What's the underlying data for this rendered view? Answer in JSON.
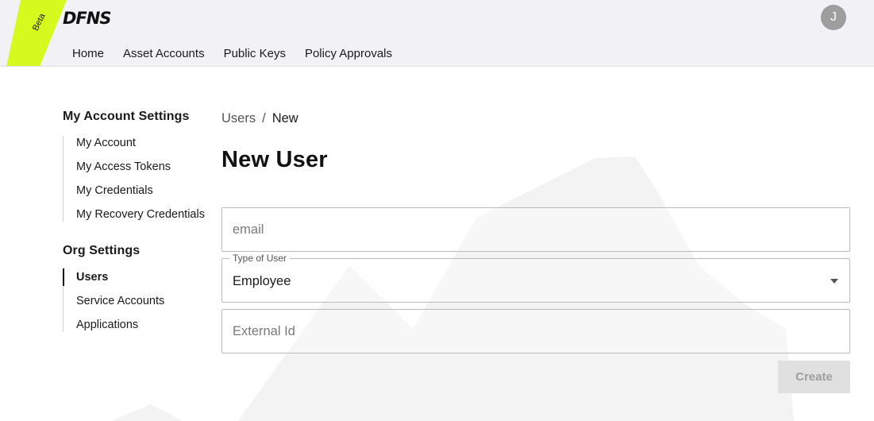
{
  "ribbon": {
    "label": "Beta",
    "color": "#d6fa1e"
  },
  "brand": {
    "logo_text": "DFNS"
  },
  "nav": {
    "items": [
      {
        "label": "Home"
      },
      {
        "label": "Asset Accounts"
      },
      {
        "label": "Public Keys"
      },
      {
        "label": "Policy Approvals"
      }
    ]
  },
  "user": {
    "avatar_initial": "J"
  },
  "sidebar": {
    "account_heading": "My Account Settings",
    "account_items": [
      {
        "label": "My Account"
      },
      {
        "label": "My Access Tokens"
      },
      {
        "label": "My Credentials"
      },
      {
        "label": "My Recovery Credentials"
      }
    ],
    "org_heading": "Org Settings",
    "org_items": [
      {
        "label": "Users",
        "active": true
      },
      {
        "label": "Service Accounts"
      },
      {
        "label": "Applications"
      }
    ]
  },
  "breadcrumb": {
    "parent": "Users",
    "separator": "/",
    "current": "New"
  },
  "page": {
    "title": "New User"
  },
  "form": {
    "email": {
      "placeholder": "email",
      "value": ""
    },
    "user_type": {
      "legend": "Type of User",
      "value": "Employee"
    },
    "external_id": {
      "placeholder": "External Id",
      "value": ""
    },
    "create_label": "Create"
  }
}
